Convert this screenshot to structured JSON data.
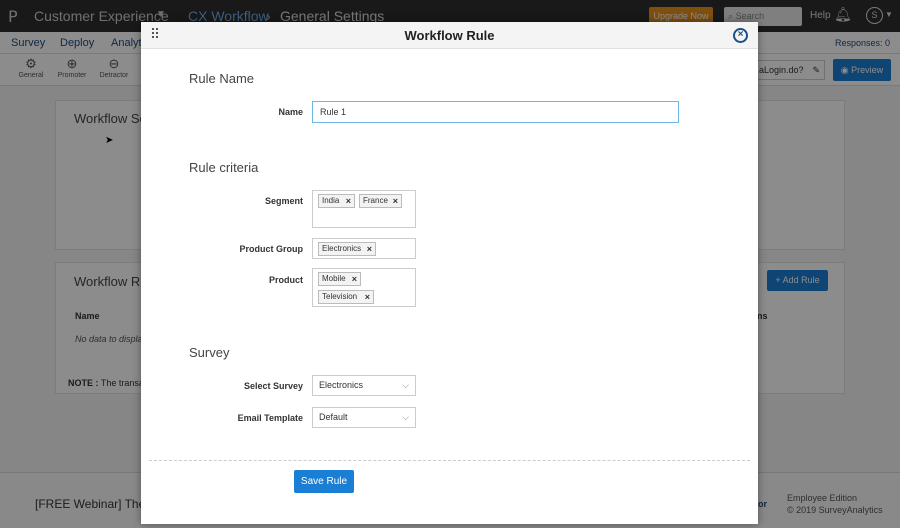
{
  "topbar": {
    "logo": "P",
    "app_switcher": "Customer Experience",
    "breadcrumb_1": "CX Workflow",
    "breadcrumb_sep": "›",
    "breadcrumb_2": "General Settings",
    "upgrade_label": "Upgrade Now",
    "search_placeholder": "Search",
    "help_label": "Help",
    "avatar_initial": "S"
  },
  "menu": {
    "items": [
      "Survey",
      "Deploy",
      "Analyti"
    ],
    "responses": "Responses: 0"
  },
  "toolbar": {
    "tools": [
      "General",
      "Promoter",
      "Detractor"
    ],
    "url_value": "aLogin.do?",
    "preview_label": "Preview"
  },
  "background": {
    "workflow_settings_title": "Workflow Set",
    "workflow_rules_title": "Workflow Ru",
    "table_header_name": "Name",
    "table_header_right": "ns",
    "no_data": "No data to displa",
    "note_label": "NOTE :",
    "note_text": "The transact",
    "add_rule_label": "+ Add Rule"
  },
  "footer": {
    "webinar_text": "[FREE Webinar] The in",
    "tor_text": "or",
    "edition": "Employee Edition",
    "copyright": "© 2019 SurveyAnalytics"
  },
  "modal": {
    "title": "Workflow Rule",
    "rule_name_section": "Rule Name",
    "name_label": "Name",
    "name_value": "Rule 1",
    "rule_criteria_section": "Rule criteria",
    "segment_label": "Segment",
    "segment_tags": [
      "India",
      "France"
    ],
    "product_group_label": "Product Group",
    "product_group_tags": [
      "Electronics"
    ],
    "product_label": "Product",
    "product_tags": [
      "Mobile",
      "Television"
    ],
    "survey_section": "Survey",
    "select_survey_label": "Select Survey",
    "select_survey_value": "Electronics",
    "email_template_label": "Email Template",
    "email_template_value": "Default",
    "save_label": "Save Rule"
  }
}
